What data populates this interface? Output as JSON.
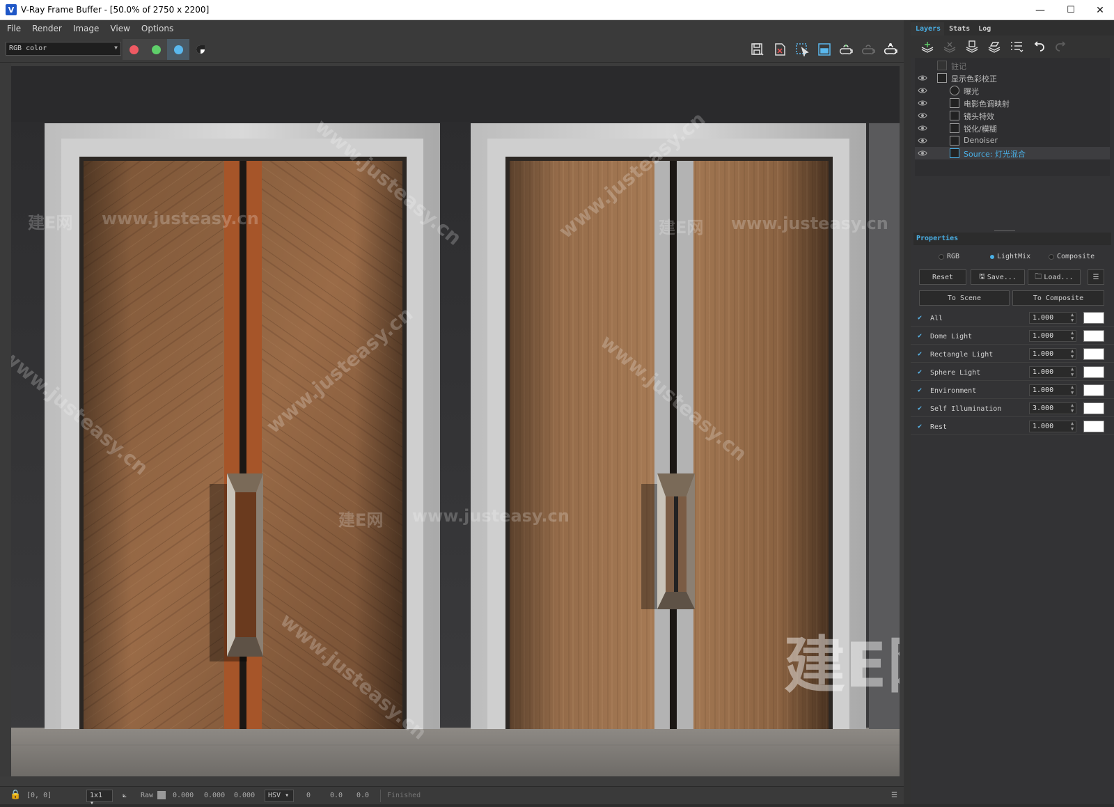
{
  "window": {
    "title": "V-Ray Frame Buffer - [50.0% of 2750 x 2200]",
    "minimize": "—",
    "maximize": "☐",
    "close": "✕"
  },
  "menu": [
    "File",
    "Render",
    "Image",
    "View",
    "Options"
  ],
  "toolbar": {
    "channel_select": "RGB color",
    "color_buttons": [
      {
        "name": "red-channel",
        "color": "#ef5a63"
      },
      {
        "name": "green-channel",
        "color": "#5fcf6a"
      },
      {
        "name": "blue-channel",
        "color": "#5ab8ee"
      }
    ],
    "right_icons": [
      "save-image-icon",
      "clear-image-icon",
      "region-render-icon",
      "track-mouse-icon",
      "render-last-icon",
      "interactive-render-icon",
      "render-icon"
    ]
  },
  "right_panel": {
    "tabs": [
      "Layers",
      "Stats",
      "Log"
    ],
    "active_tab": "Layers",
    "layer_tools": [
      "create-layer-icon",
      "delete-layer-icon",
      "save-layers-icon",
      "load-layers-icon",
      "layer-list-icon",
      "undo-icon",
      "redo-icon"
    ],
    "layers": [
      {
        "name": "註记",
        "indent": 0,
        "visible": false,
        "selected": false
      },
      {
        "name": "显示色彩校正",
        "indent": 0,
        "visible": true,
        "selected": false
      },
      {
        "name": "曝光",
        "indent": 1,
        "visible": true,
        "selected": false
      },
      {
        "name": "电影色调映射",
        "indent": 1,
        "visible": true,
        "selected": false
      },
      {
        "name": "镜头特效",
        "indent": 1,
        "visible": true,
        "selected": false
      },
      {
        "name": "锐化/模糊",
        "indent": 1,
        "visible": true,
        "selected": false
      },
      {
        "name": "Denoiser",
        "indent": 1,
        "visible": true,
        "selected": false
      },
      {
        "name": "Source: 灯光混合",
        "indent": 1,
        "visible": true,
        "selected": true
      }
    ],
    "properties_title": "Properties",
    "modes": [
      "RGB",
      "LightMix",
      "Composite"
    ],
    "active_mode": "LightMix",
    "buttons": {
      "reset": "Reset",
      "save": "Save...",
      "load": "Load...",
      "to_scene": "To Scene",
      "to_composite": "To Composite"
    },
    "lightmix": [
      {
        "label": "All",
        "value": "1.000",
        "checked": true
      },
      {
        "label": "Dome Light",
        "value": "1.000",
        "checked": true
      },
      {
        "label": "Rectangle Light",
        "value": "1.000",
        "checked": true
      },
      {
        "label": "Sphere Light",
        "value": "1.000",
        "checked": true
      },
      {
        "label": "Environment",
        "value": "1.000",
        "checked": true
      },
      {
        "label": "Self Illumination",
        "value": "3.000",
        "checked": true
      },
      {
        "label": "Rest",
        "value": "1.000",
        "checked": true
      }
    ]
  },
  "status": {
    "coords": "[0, 0]",
    "zoom": "1x1",
    "raw_label": "Raw",
    "raw_values": [
      "0.000",
      "0.000",
      "0.000"
    ],
    "color_space": "HSV",
    "hsv_values": [
      "0",
      "0.0",
      "0.0"
    ],
    "state": "Finished"
  },
  "watermarks": {
    "site": "www.justeasy.cn",
    "brand": "建E网"
  }
}
